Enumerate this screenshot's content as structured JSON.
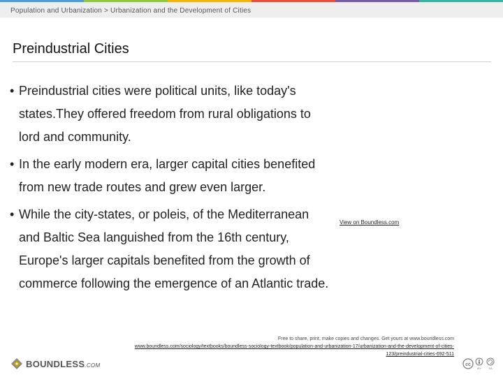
{
  "header": {
    "breadcrumb": "Population and Urbanization > Urbanization and the Development of Cities",
    "accent_colors": [
      "#4a9fd8",
      "#8ec63f",
      "#f4b400",
      "#e94e3d",
      "#7a5aa8",
      "#3ab0a0"
    ]
  },
  "slide": {
    "title": "Preindustrial Cities",
    "bullet_glyph": "•",
    "bullets": [
      "Preindustrial cities were political units, like today's states.They offered freedom from rural obligations to lord and community.",
      "In the early modern era, larger capital cities benefited from new trade routes and grew even larger.",
      "While the city-states, or poleis, of the Mediterranean and Baltic Sea languished from the 16th century, Europe's larger capitals benefited from the growth of commerce following the emergence of an Atlantic trade."
    ],
    "view_link": "View on Boundless.com"
  },
  "footer": {
    "logo_text": "BOUNDLESS",
    "logo_suffix": ".COM",
    "notice": "Free to share, print, make copies and changes. Get yours at www.boundless.com",
    "url": "www.boundless.com/sociology/textbooks/boundless-sociology-textbook/population-and-urbanization-17/urbanization-and-the-development-of-cities-123/preindustrial-cities-692-511",
    "license_icon": "cc-by-sa-icon"
  }
}
